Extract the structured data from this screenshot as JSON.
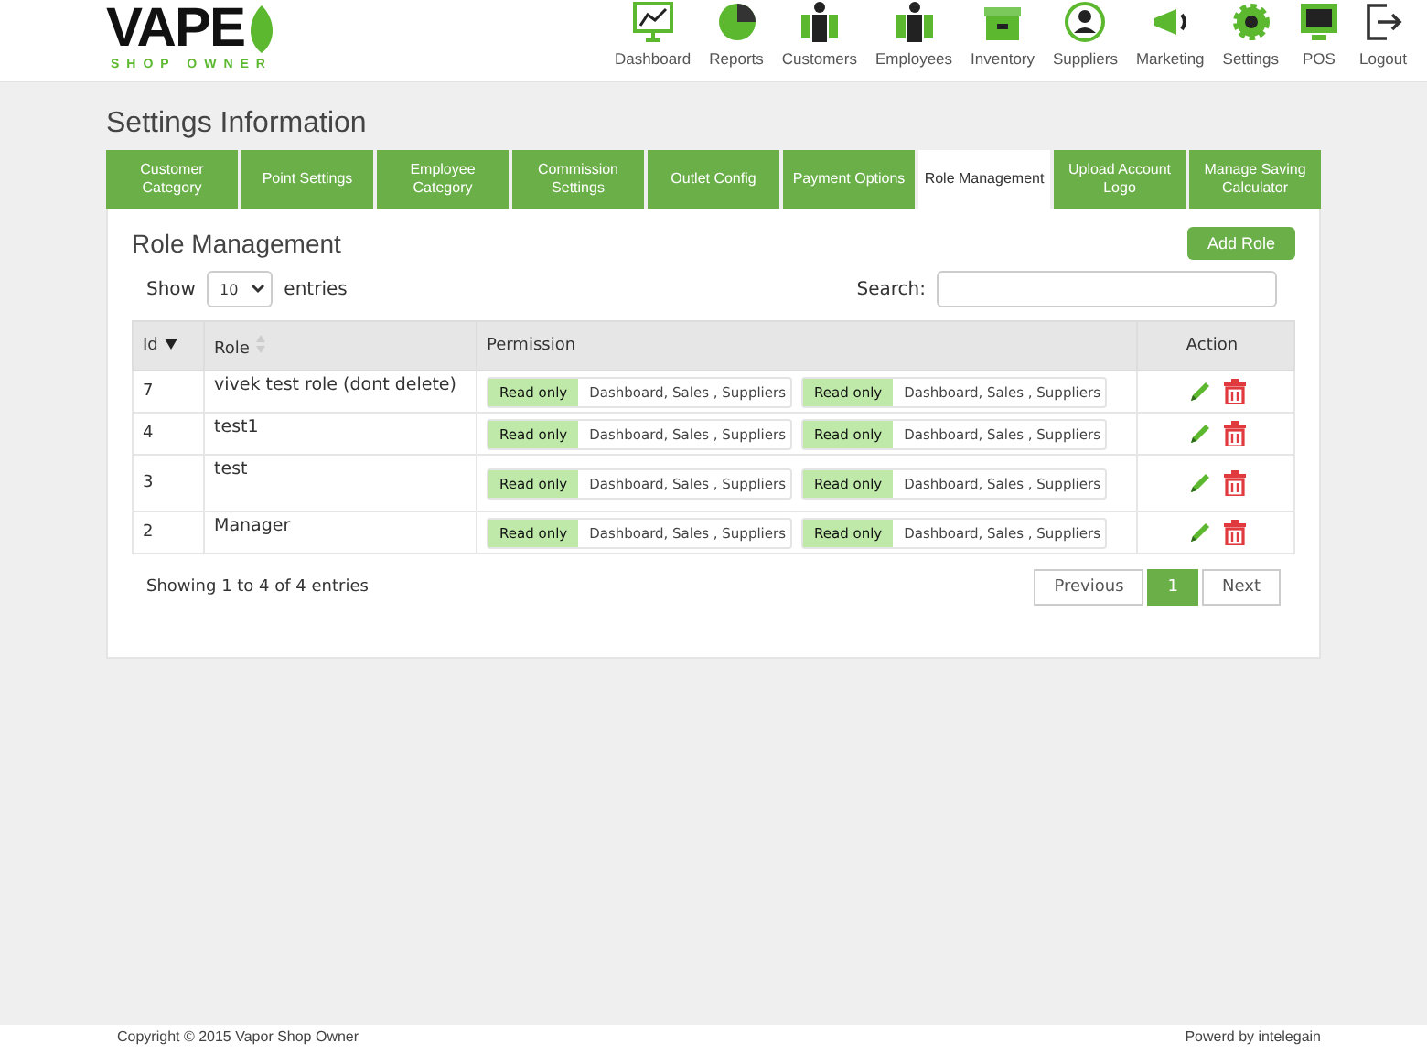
{
  "logo": {
    "word": "VAPE",
    "tagline": "SHOP OWNER"
  },
  "nav": [
    {
      "label": "Dashboard",
      "kind": "chart"
    },
    {
      "label": "Reports",
      "kind": "pie"
    },
    {
      "label": "Customers",
      "kind": "people"
    },
    {
      "label": "Employees",
      "kind": "people"
    },
    {
      "label": "Inventory",
      "kind": "box"
    },
    {
      "label": "Suppliers",
      "kind": "person"
    },
    {
      "label": "Marketing",
      "kind": "megaphone"
    },
    {
      "label": "Settings",
      "kind": "gear"
    },
    {
      "label": "POS",
      "kind": "monitor"
    },
    {
      "label": "Logout",
      "kind": "exit"
    }
  ],
  "page_title": "Settings Information",
  "tabs": [
    {
      "label": "Customer Category",
      "selected": false
    },
    {
      "label": "Point Settings",
      "selected": false
    },
    {
      "label": "Employee Category",
      "selected": false
    },
    {
      "label": "Commission Settings",
      "selected": false
    },
    {
      "label": "Outlet Config",
      "selected": false
    },
    {
      "label": "Payment Options",
      "selected": false
    },
    {
      "label": "Role Management",
      "selected": true
    },
    {
      "label": "Upload Account Logo",
      "selected": false
    },
    {
      "label": "Manage Saving Calculator",
      "selected": false
    }
  ],
  "panel": {
    "title": "Role Management",
    "add_button": "Add Role",
    "show_label": "Show",
    "page_size": "10",
    "entries_label": "entries",
    "search_label": "Search:"
  },
  "table": {
    "columns": [
      "Id",
      "Role",
      "Permission",
      "Action"
    ],
    "rows": [
      {
        "id": "7",
        "role": "vivek test role (dont delete)",
        "permissions": [
          {
            "access": "Read only",
            "modules": "Dashboard, Sales , Suppliers"
          },
          {
            "access": "Read only",
            "modules": "Dashboard, Sales , Suppliers"
          }
        ]
      },
      {
        "id": "4",
        "role": "test1",
        "permissions": [
          {
            "access": "Read only",
            "modules": "Dashboard, Sales , Suppliers"
          },
          {
            "access": "Read only",
            "modules": "Dashboard, Sales , Suppliers"
          }
        ]
      },
      {
        "id": "3",
        "role": "test",
        "permissions": [
          {
            "access": "Read only",
            "modules": "Dashboard, Sales , Suppliers"
          },
          {
            "access": "Read only",
            "modules": "Dashboard, Sales , Suppliers"
          }
        ]
      },
      {
        "id": "2",
        "role": "Manager",
        "permissions": [
          {
            "access": "Read only",
            "modules": "Dashboard, Sales , Suppliers"
          },
          {
            "access": "Read only",
            "modules": "Dashboard, Sales , Suppliers"
          }
        ]
      }
    ]
  },
  "info": "Showing 1 to 4 of 4 entries",
  "pagination": [
    {
      "label": "Previous",
      "selected": false
    },
    {
      "label": "1",
      "selected": true
    },
    {
      "label": "Next",
      "selected": false
    }
  ],
  "footer": {
    "copyright": "Copyright © 2015 Vapor Shop Owner",
    "powered": "Powerd by intelegain"
  }
}
